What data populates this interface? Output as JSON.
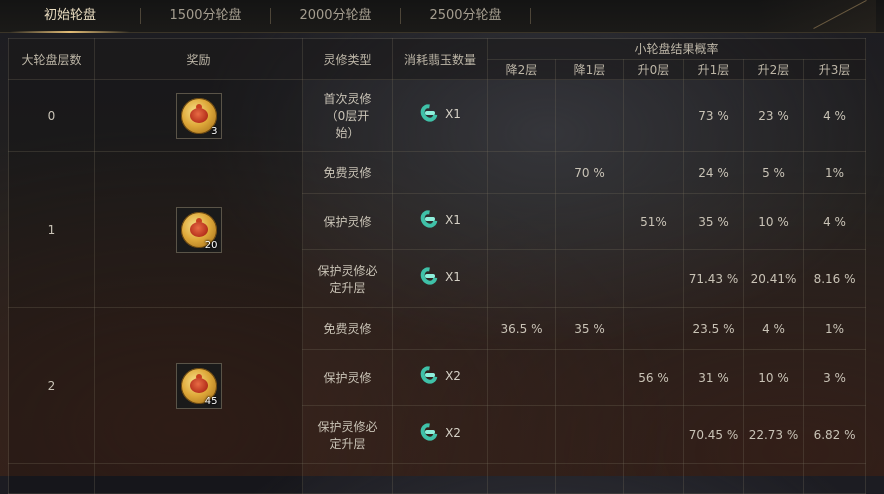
{
  "tabs": [
    {
      "label": "初始轮盘",
      "active": true
    },
    {
      "label": "1500分轮盘",
      "active": false
    },
    {
      "label": "2000分轮盘",
      "active": false
    },
    {
      "label": "2500分轮盘",
      "active": false
    }
  ],
  "headers": {
    "layer": "大轮盘层数",
    "reward": "奖励",
    "type": "灵修类型",
    "cost": "消耗翡玉数量",
    "prob_group": "小轮盘结果概率",
    "cols": [
      "降2层",
      "降1层",
      "升0层",
      "升1层",
      "升2层",
      "升3层"
    ]
  },
  "colors": {
    "accent": "#e3bd77",
    "jade": "#3fc1a8",
    "coin": "#dfa93a"
  },
  "groups": [
    {
      "layer": "0",
      "reward_count": "3",
      "reward_icon": "lucky-bag-coin-icon",
      "rows": [
        {
          "type": "首次灵修（0层开始）",
          "cost": "X1",
          "probs": [
            "",
            "",
            "",
            "73 %",
            "23 %",
            "4 %"
          ]
        }
      ]
    },
    {
      "layer": "1",
      "reward_count": "20",
      "reward_icon": "lucky-bag-coin-icon",
      "rows": [
        {
          "type": "免费灵修",
          "cost": "",
          "probs": [
            "",
            "70 %",
            "",
            "24 %",
            "5 %",
            "1%"
          ]
        },
        {
          "type": "保护灵修",
          "cost": "X1",
          "probs": [
            "",
            "",
            "51%",
            "35 %",
            "10 %",
            "4 %"
          ]
        },
        {
          "type": "保护灵修必定升层",
          "cost": "X1",
          "probs": [
            "",
            "",
            "",
            "71.43 %",
            "20.41%",
            "8.16 %"
          ]
        }
      ]
    },
    {
      "layer": "2",
      "reward_count": "45",
      "reward_icon": "lucky-bag-coin-icon",
      "rows": [
        {
          "type": "免费灵修",
          "cost": "",
          "probs": [
            "36.5 %",
            "35 %",
            "",
            "23.5 %",
            "4 %",
            "1%"
          ]
        },
        {
          "type": "保护灵修",
          "cost": "X2",
          "probs": [
            "",
            "",
            "56 %",
            "31 %",
            "10 %",
            "3 %"
          ]
        },
        {
          "type": "保护灵修必定升层",
          "cost": "X2",
          "probs": [
            "",
            "",
            "",
            "70.45 %",
            "22.73 %",
            "6.82 %"
          ]
        }
      ]
    }
  ]
}
